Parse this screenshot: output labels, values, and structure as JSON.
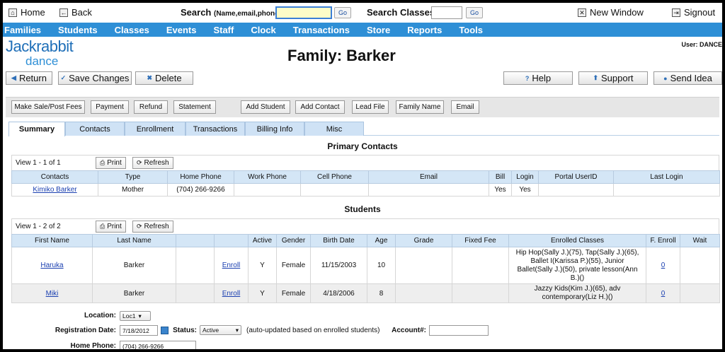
{
  "toolbar": {
    "home": "Home",
    "back": "Back",
    "search_label": "Search",
    "search_hint": "(Name,email,phone)",
    "search_value": "",
    "go": "Go",
    "search_classes_label": "Search Classes:",
    "search_classes_value": "",
    "go2": "Go",
    "new_window": "New Window",
    "signout": "Signout"
  },
  "nav": [
    "Families",
    "Students",
    "Classes",
    "Events",
    "Staff",
    "Clock",
    "Transactions",
    "Store",
    "Reports",
    "Tools"
  ],
  "logo": {
    "line1": "Jackrabbit",
    "line2": "dance"
  },
  "page_title": "Family: Barker",
  "user": "User: DANCE",
  "actions": {
    "return": "Return",
    "save": "Save Changes",
    "delete": "Delete",
    "help": "Help",
    "support": "Support",
    "send_idea": "Send Idea"
  },
  "graybar": [
    "Make Sale/Post Fees",
    "Payment",
    "Refund",
    "Statement",
    "Add Student",
    "Add Contact",
    "Lead File",
    "Family Name",
    "Email"
  ],
  "tabs": [
    "Summary",
    "Contacts",
    "Enrollment",
    "Transactions",
    "Billing Info",
    "Misc"
  ],
  "contacts": {
    "title": "Primary Contacts",
    "view": "View 1 - 1 of 1",
    "print": "Print",
    "refresh": "Refresh",
    "headers": [
      "Contacts",
      "Type",
      "Home Phone",
      "Work Phone",
      "Cell Phone",
      "Email",
      "Bill",
      "Login",
      "Portal UserID",
      "Last Login"
    ],
    "rows": [
      [
        "Kimiko Barker",
        "Mother",
        "(704) 266-9266",
        "",
        "",
        "",
        "Yes",
        "Yes",
        "",
        ""
      ]
    ]
  },
  "students": {
    "title": "Students",
    "view": "View 1 - 2 of 2",
    "print": "Print",
    "refresh": "Refresh",
    "headers": [
      "First Name",
      "Last Name",
      "",
      "",
      "Active",
      "Gender",
      "Birth Date",
      "Age",
      "Grade",
      "Fixed Fee",
      "Enrolled Classes",
      "F. Enroll",
      "Wait"
    ],
    "rows": [
      [
        "Haruka",
        "Barker",
        "",
        "Enroll",
        "Y",
        "Female",
        "11/15/2003",
        "10",
        "",
        "",
        "Hip Hop(Sally J.)(75), Tap(Sally J.)(65), Ballet I(Karissa P.)(55), Junior Ballet(Sally J.)(50), private lesson(Ann B.)()",
        "0",
        ""
      ],
      [
        "Miki",
        "Barker",
        "",
        "Enroll",
        "Y",
        "Female",
        "4/18/2006",
        "8",
        "",
        "",
        "Jazzy Kids(Kim J.)(65), adv contemporary(Liz H.)()",
        "0",
        ""
      ]
    ]
  },
  "form": {
    "location_label": "Location:",
    "location_value": "Loc1",
    "reg_label": "Registration Date:",
    "reg_value": "7/18/2012",
    "status_label": "Status:",
    "status_value": "Active",
    "status_note": "(auto-updated based on enrolled students)",
    "account_label": "Account#:",
    "account_value": "",
    "home_phone_label": "Home Phone:",
    "home_phone_value": "(704) 266-9266"
  }
}
